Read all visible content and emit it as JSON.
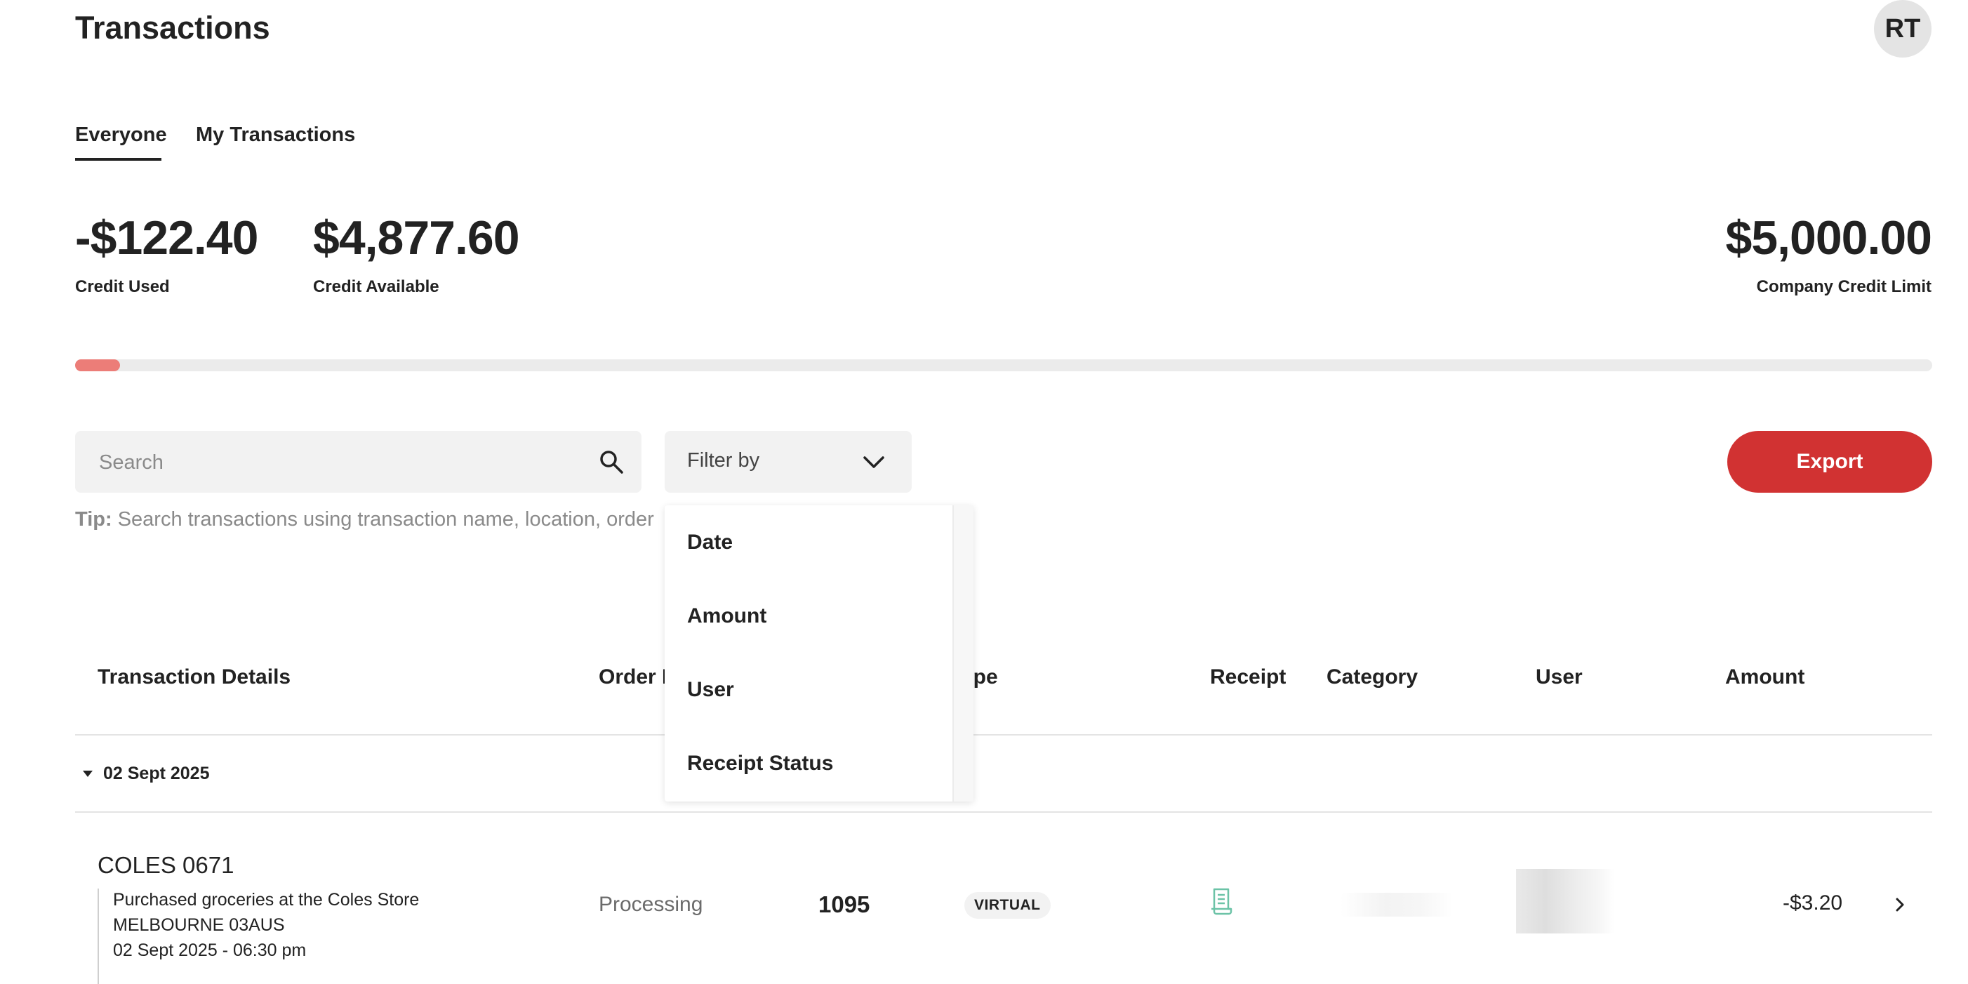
{
  "header": {
    "title": "Transactions",
    "avatar_initials": "RT"
  },
  "tabs": [
    {
      "label": "Everyone",
      "active": true
    },
    {
      "label": "My Transactions",
      "active": false
    }
  ],
  "credit": {
    "used_amount": "-$122.40",
    "used_label": "Credit Used",
    "available_amount": "$4,877.60",
    "available_label": "Credit Available",
    "limit_amount": "$5,000.00",
    "limit_label": "Company Credit Limit",
    "usage_fraction": 0.024,
    "bar_fill_color": "#ec7d78",
    "bar_track_color": "#ebebeb"
  },
  "search": {
    "placeholder": "Search",
    "icon": "search-icon"
  },
  "filter": {
    "label": "Filter by",
    "icon": "chevron-down-icon",
    "options": [
      "Date",
      "Amount",
      "User",
      "Receipt Status"
    ]
  },
  "export": {
    "label": "Export",
    "color": "#d13232"
  },
  "tip": {
    "prefix": "Tip:",
    "text": "Search transactions using transaction name, location, order"
  },
  "table": {
    "columns": [
      "Transaction Details",
      "Order I",
      "ype",
      "Receipt",
      "Category",
      "User",
      "Amount"
    ],
    "groups": [
      {
        "date": "02 Sept 2025",
        "rows": [
          {
            "merchant": "COLES 0671",
            "description": "Purchased groceries at the Coles Store",
            "location": "MELBOURNE 03AUS",
            "datetime": "02 Sept 2025 - 06:30 pm",
            "status": "Processing",
            "order_number": "1095",
            "type": "VIRTUAL",
            "receipt_icon": "receipt-icon",
            "amount": "-$3.20"
          }
        ]
      }
    ]
  }
}
